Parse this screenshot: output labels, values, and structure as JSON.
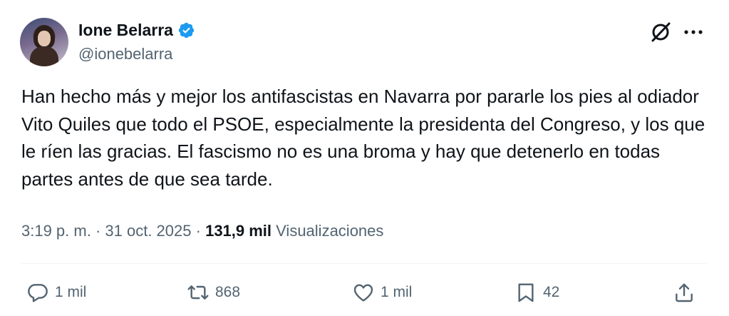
{
  "author": {
    "display_name": "Ione Belarra",
    "handle": "@ionebelarra",
    "verified_icon": "verified-badge-icon",
    "verified_color": "#1d9bf0"
  },
  "header_actions": {
    "grok_icon": "grok-icon",
    "more_icon": "more-dots-icon"
  },
  "tweet": {
    "text": "Han hecho más y mejor los antifascistas en Navarra por pararle los pies al odiador Vito Quiles que todo el PSOE, especialmente la presidenta del Congreso, y los que le ríen las gracias. El fascismo no es una broma y hay que detenerlo en todas partes antes de que sea tarde."
  },
  "meta": {
    "time": "3:19 p. m.",
    "separator": " · ",
    "date": "31 oct. 2025",
    "views_count": "131,9 mil",
    "views_label": "Visualizaciones"
  },
  "actions": {
    "reply": {
      "icon": "reply-icon",
      "count": "1 mil"
    },
    "repost": {
      "icon": "repost-icon",
      "count": "868"
    },
    "like": {
      "icon": "heart-icon",
      "count": "1 mil"
    },
    "bookmark": {
      "icon": "bookmark-icon",
      "count": "42"
    },
    "share": {
      "icon": "share-icon"
    }
  },
  "colors": {
    "text": "#0f1419",
    "secondary": "#536471",
    "divider": "#eff3f4"
  }
}
